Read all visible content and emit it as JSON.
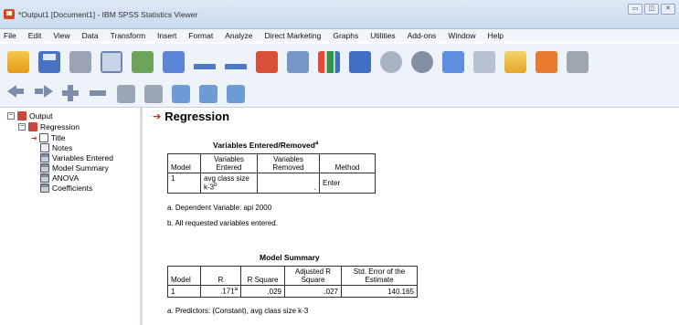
{
  "window": {
    "title": "*Output1 [Document1] - IBM SPSS Statistics Viewer",
    "controls": [
      "▭",
      "◫",
      "✕"
    ]
  },
  "menu": [
    "File",
    "Edit",
    "View",
    "Data",
    "Transform",
    "Insert",
    "Format",
    "Analyze",
    "Direct Marketing",
    "Graphs",
    "Utilities",
    "Add-ons",
    "Window",
    "Help"
  ],
  "nav": {
    "root": "Output",
    "section": "Regression",
    "items": [
      "Title",
      "Notes",
      "Variables Entered",
      "Model Summary",
      "ANOVA",
      "Coefficients"
    ]
  },
  "output": {
    "heading": "Regression",
    "var_table": {
      "title": "Variables Entered/Removed",
      "title_sup": "a",
      "headers": [
        "Model",
        "Variables Entered",
        "Variables Removed",
        "Method"
      ],
      "row": {
        "model": "1",
        "entered": "avg class size k-3",
        "entered_sup": "b",
        "removed": ".",
        "method": "Enter"
      },
      "notes": [
        "a. Dependent Variable: api 2000",
        "b. All requested variables entered."
      ]
    },
    "summary_table": {
      "title": "Model Summary",
      "headers": [
        "Model",
        "R",
        "R Square",
        "Adjusted R Square",
        "Std. Error of the Estimate"
      ],
      "row": {
        "model": "1",
        "r": ".171",
        "r_sup": "a",
        "r_square": ".029",
        "adj_r_square": ".027",
        "std_error": "140.165"
      },
      "notes": [
        "a. Predictors: (Constant), avg class size k-3"
      ]
    }
  }
}
